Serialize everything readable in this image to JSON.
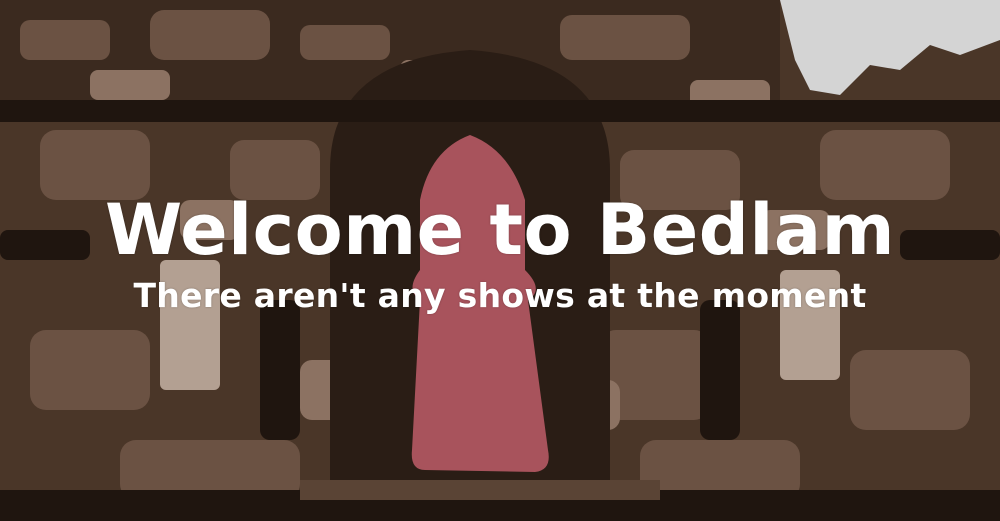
{
  "hero": {
    "title": "Welcome to Bedlam",
    "subtitle": "There aren't any shows at the moment"
  },
  "colors": {
    "text": "#ffffff",
    "door": "#a8535c",
    "sky": "#d6d6d6",
    "stone_dark": "#2a1d15",
    "stone_mid": "#5a4435",
    "stone_light": "#7d6454",
    "stone_pale": "#b19d8c"
  },
  "background": {
    "description_icon": "brick-archway-illustration-icon"
  }
}
